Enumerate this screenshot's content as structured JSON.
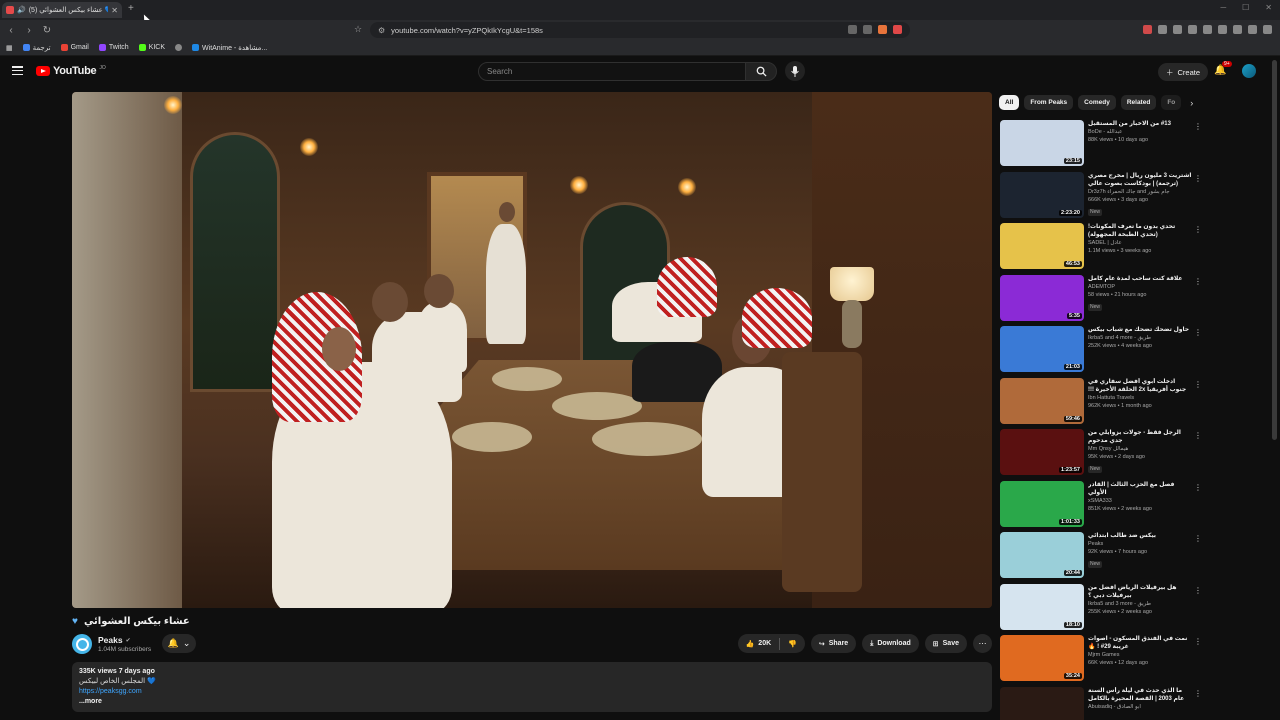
{
  "browser": {
    "tab_title": "(5) عشاء بيكس العشوائي 💙",
    "url": "youtube.com/watch?v=yZPQkIkYcgU&t=158s",
    "bookmarks": [
      {
        "label": "ترجمة",
        "color": "#4285f4"
      },
      {
        "label": "Gmail",
        "color": "#ea4335"
      },
      {
        "label": "Twitch",
        "color": "#9146ff"
      },
      {
        "label": "KICK",
        "color": "#53fc18"
      },
      {
        "label": "",
        "color": "#888888"
      },
      {
        "label": "WitAnime - مشاهدة...",
        "color": "#1e88e5"
      }
    ]
  },
  "header": {
    "logo": "YouTube",
    "logo_region": "JO",
    "search_placeholder": "Search",
    "create_label": "Create",
    "notif_count": "9+"
  },
  "video": {
    "title": "عشاء بيكس العشوائي",
    "channel": "Peaks",
    "subscribers": "1.04M subscribers",
    "likes": "20K",
    "share": "Share",
    "download": "Download",
    "save": "Save",
    "desc_meta": "335K views  7 days ago",
    "desc_line": "المجلس الخاص لبيكس 💙",
    "desc_link": "https://peaksgg.com",
    "desc_more": "...more"
  },
  "sidebar": {
    "chips": [
      "All",
      "From Peaks",
      "Comedy",
      "Related",
      "Fo"
    ],
    "items": [
      {
        "title": "#13 من الاخبار من المستقبل",
        "channel": "BoDe - عبدالله",
        "views": "88K views • 10 days ago",
        "duration": "23:15",
        "is_new": false,
        "thumb": "#c9d6e6"
      },
      {
        "title": "اشتريت 3 مليون ريال | مخرج مصري (ترجمة) | بودكاست بصوت عالي",
        "channel": "Dr3z7h جاك الحمراء and جام بشور",
        "views": "666K views • 3 days ago",
        "duration": "2:23:20",
        "is_new": true,
        "thumb": "#1c2430"
      },
      {
        "title": "تحدي بدون ما تعرف المكونات! (تحدي الطبخة المجهولة)",
        "channel": "SADEL | عادل",
        "views": "1.1M views • 3 weeks ago",
        "duration": "46:53",
        "is_new": false,
        "thumb": "#e6c24a"
      },
      {
        "title": "علاقة كنت ساحب لمدة عام كامل",
        "channel": "ADEMTOP",
        "views": "58 views • 21 hours ago",
        "duration": "5:35",
        "is_new": true,
        "thumb": "#8b2ad6"
      },
      {
        "title": "حاول تضحك تضحك مع شباب بيكس",
        "channel": "Ikrba5 and 4 more - طريق",
        "views": "252K views • 4 weeks ago",
        "duration": "21:03",
        "is_new": false,
        "thumb": "#3a7ad6"
      },
      {
        "title": "ادخلت أبوي أفضل سفاري في جنوب أفريقيا 2x الحلقة الأخيرة !!!",
        "channel": "Ibn Hattuta Travels",
        "views": "962K views • 1 month ago",
        "duration": "59:46",
        "is_new": false,
        "thumb": "#b06a3a"
      },
      {
        "title": "الرجل فقط - جولات بزوايلي من جدي مدحوم",
        "channel": "Mm Qnsy هيمالل",
        "views": "95K views • 2 days ago",
        "duration": "1:23:57",
        "is_new": true,
        "thumb": "#5a1010"
      },
      {
        "title": "فصل مع الحزب الثالث | القادر الأولي",
        "channel": "xSMA333",
        "views": "851K views • 2 weeks ago",
        "duration": "1:01:33",
        "is_new": false,
        "thumb": "#2aa84a"
      },
      {
        "title": "بيكس ضد طالب ابتدائي",
        "channel": "Peaks",
        "views": "92K views • 7 hours ago",
        "duration": "20:44",
        "is_new": true,
        "thumb": "#9acfd9"
      },
      {
        "title": "هل بيرفيلات الرياض افضل من بيرفيلات دبي ؟",
        "channel": "Ikrba5 and 3 more - طريق",
        "views": "255K views • 2 weeks ago",
        "duration": "18:10",
        "is_new": false,
        "thumb": "#d6e4ef"
      },
      {
        "title": "نمت في الفندق المسكون - اصوات غريبة 29# ! 🔥",
        "channel": "Mjrm Games",
        "views": "66K views • 12 days ago",
        "duration": "35:24",
        "is_new": false,
        "thumb": "#e06a20"
      },
      {
        "title": "ما الذي حدث في ليلة رأس السنة عام 2003 | القصة المحيرة بالكامل",
        "channel": "Abuisadiq - ابو الصادق",
        "views": "",
        "duration": "",
        "is_new": false,
        "thumb": "#2a1a14"
      }
    ]
  }
}
